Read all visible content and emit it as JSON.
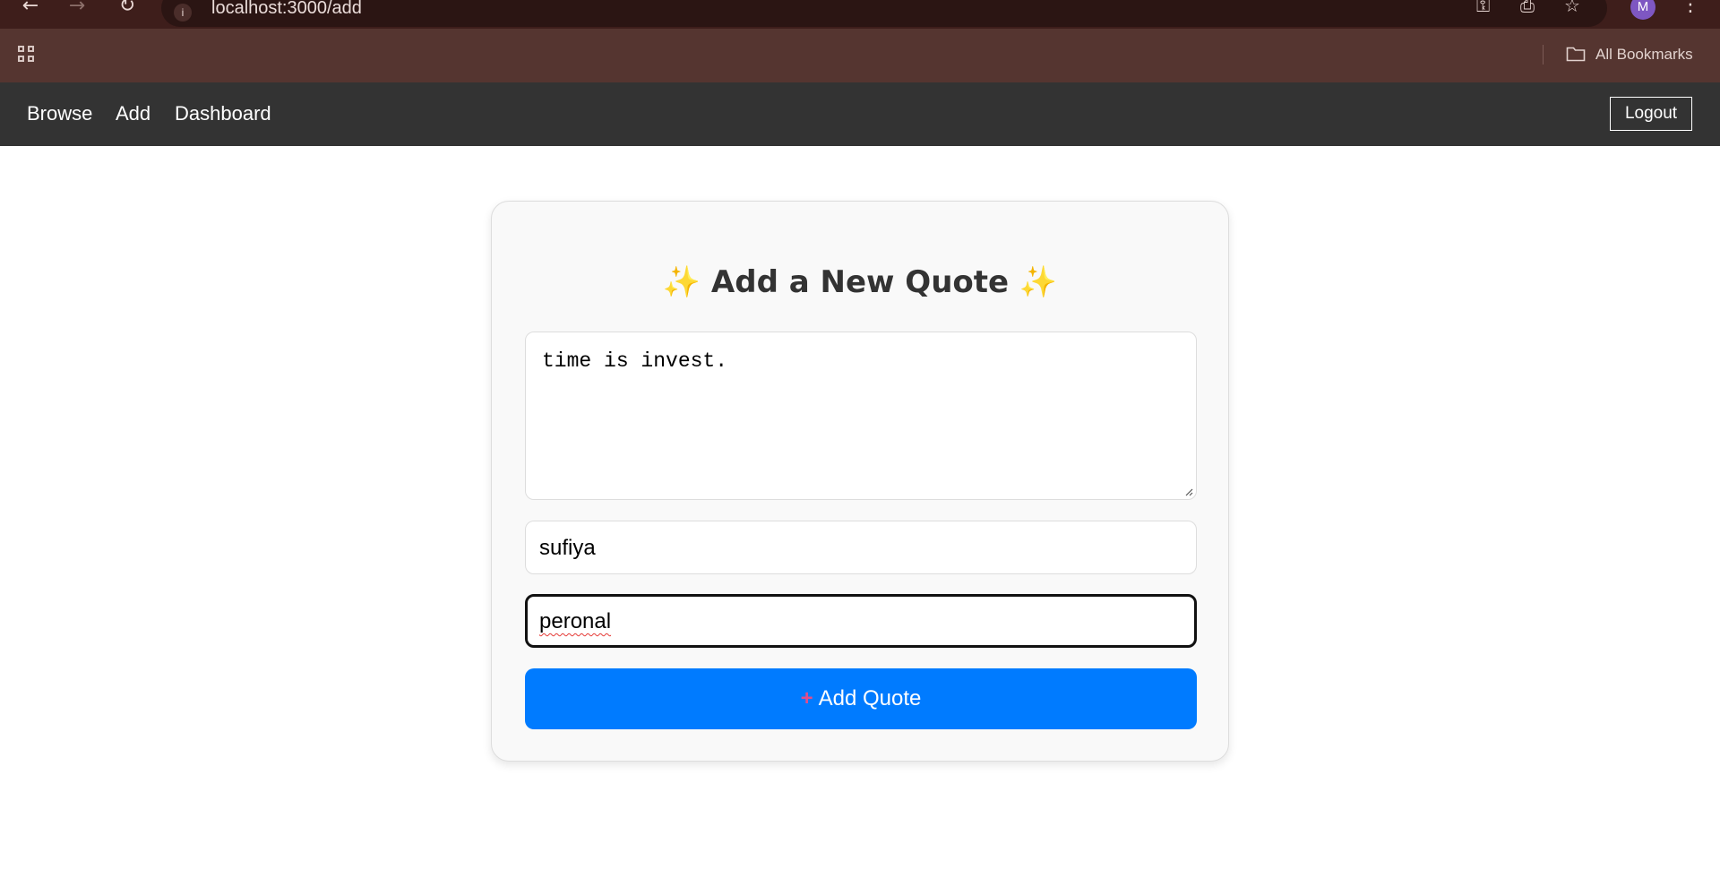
{
  "browser": {
    "url": "localhost:3000/add",
    "bookmarks_label": "All Bookmarks",
    "profile_initial": "M"
  },
  "nav": {
    "links": [
      "Browse",
      "Add",
      "Dashboard"
    ],
    "logout_label": "Logout"
  },
  "form": {
    "title": "Add a New Quote",
    "title_icon": "sparkles-icon",
    "quote_value": "time is invest.",
    "author_value": "sufiya",
    "category_value": "peronal",
    "submit_label": "Add Quote",
    "submit_icon": "plus-icon"
  },
  "colors": {
    "nav_bg": "#333333",
    "button_bg": "#007bff",
    "card_bg": "#f9f9f9"
  }
}
